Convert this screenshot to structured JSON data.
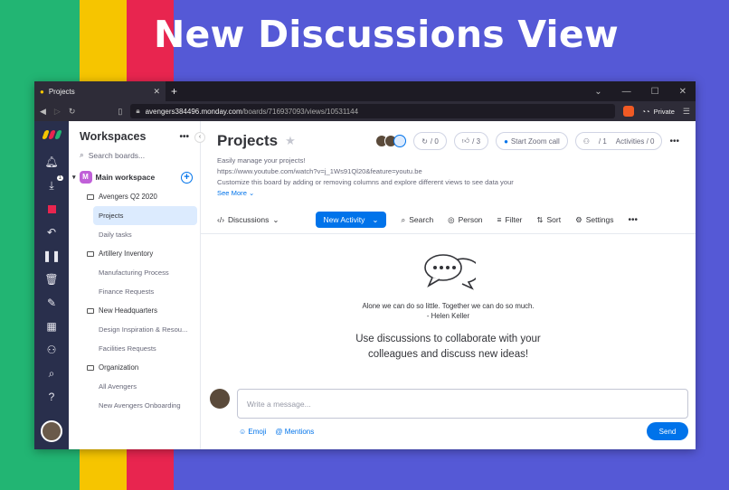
{
  "headline": "New Discussions View",
  "browser": {
    "tab_title": "Projects",
    "url_host": "avengers384496.monday.com",
    "url_path": "/boards/716937093/views/10531144",
    "private_label": "Private"
  },
  "leftnav": {
    "notification_count": "1"
  },
  "workspace": {
    "title": "Workspaces",
    "search_placeholder": "Search boards...",
    "main_name": "Main workspace",
    "main_initial": "M",
    "folders": [
      {
        "name": "Avengers Q2 2020",
        "items": [
          "Projects",
          "Daily tasks"
        ]
      },
      {
        "name": "Artillery Inventory",
        "items": [
          "Manufacturing Process",
          "Finance Requests"
        ]
      },
      {
        "name": "New Headquarters",
        "items": [
          "Design Inspiration & Resou...",
          "Facilities Requests"
        ]
      },
      {
        "name": "Organization",
        "items": [
          "All Avengers",
          "New Avengers Onboarding"
        ]
      }
    ]
  },
  "board": {
    "title": "Projects",
    "updates_count": "/ 0",
    "likes_count": "/ 3",
    "zoom_label": "Start Zoom call",
    "members_count": "/ 1",
    "activities_label": "Activities / 0",
    "desc_line1": "Easily manage your projects!",
    "desc_line2": "https://www.youtube.com/watch?v=j_1Ws91Ql20&feature=youtu.be",
    "desc_line3": "Customize this board by adding or removing columns and explore different views to see data your",
    "see_more": "See More"
  },
  "toolbar": {
    "view_label": "Discussions",
    "new_activity": "New Activity",
    "search": "Search",
    "person": "Person",
    "filter": "Filter",
    "sort": "Sort",
    "settings": "Settings"
  },
  "discussion": {
    "quote_line1": "Alone we can do so little. Together we can do so much.",
    "quote_line2": "- Helen Keller",
    "cta_line1": "Use discussions to collaborate with your",
    "cta_line2": "colleagues and discuss new ideas!",
    "message_placeholder": "Write a message...",
    "emoji": "Emoji",
    "mentions": "Mentions",
    "send": "Send"
  },
  "colors": {
    "accent": "#0073ea",
    "nav": "#292f4c",
    "background": "#5559d6"
  }
}
